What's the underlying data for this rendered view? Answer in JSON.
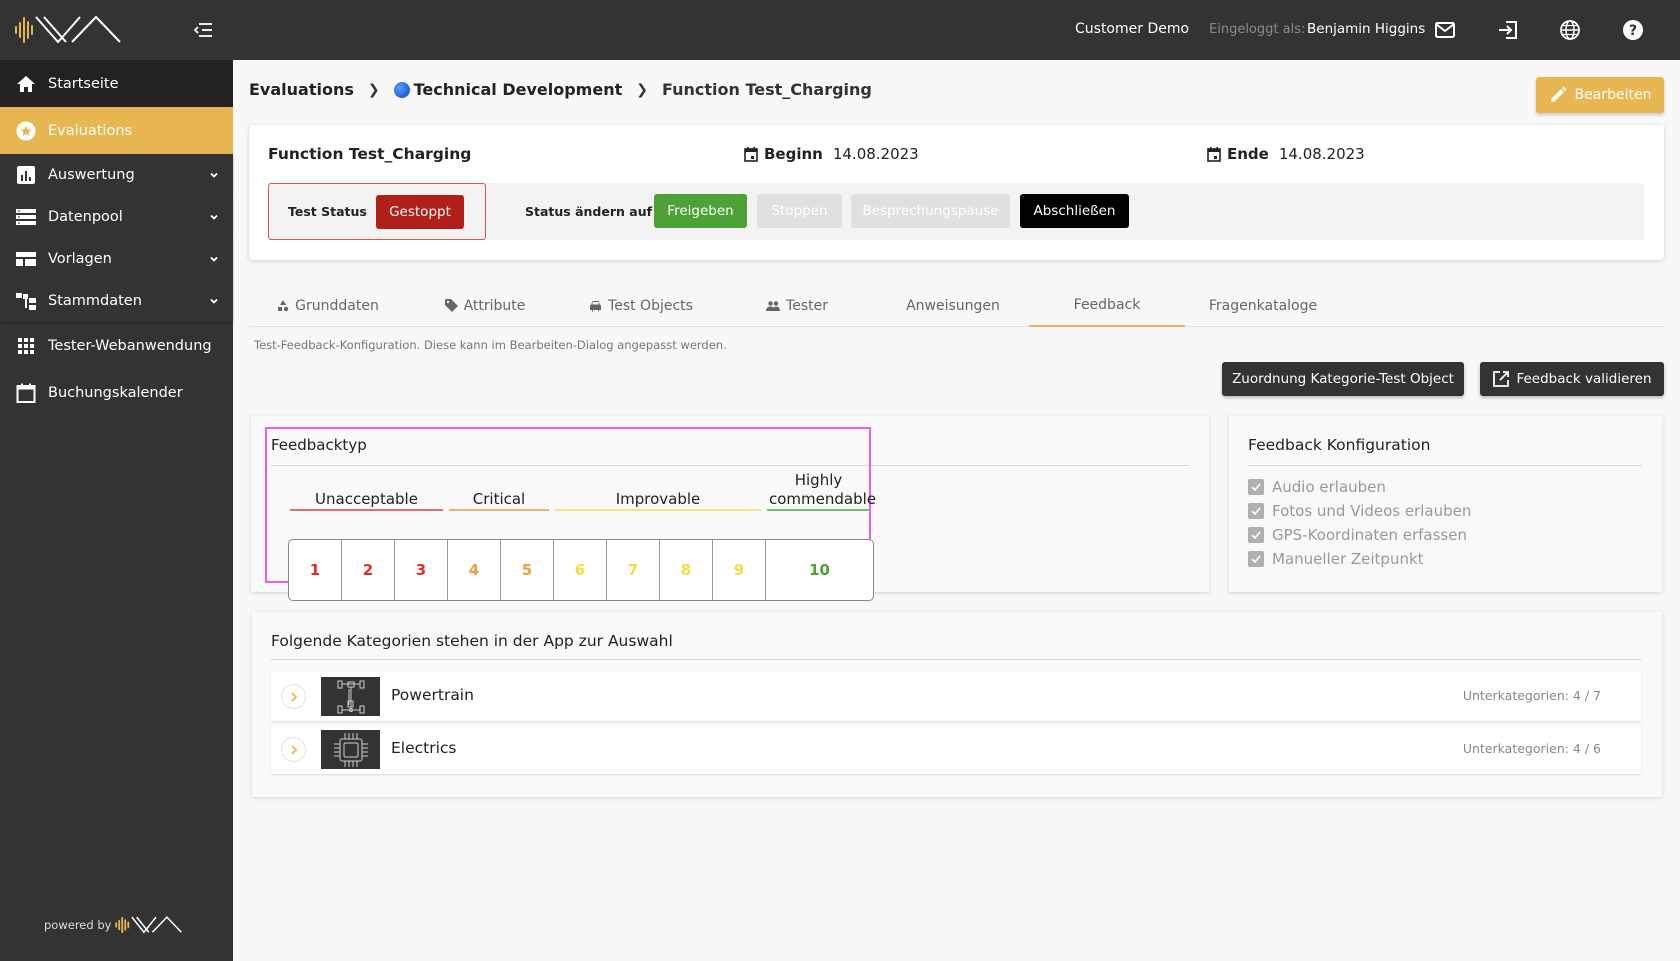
{
  "topbar": {
    "tenant": "Customer Demo",
    "logged_in_label": "Eingeloggt als:",
    "user_name": "Benjamin Higgins",
    "icons": [
      "mail-icon",
      "logout-icon",
      "globe-icon",
      "help-icon"
    ]
  },
  "sidebar": {
    "items": [
      {
        "label": "Startseite",
        "icon": "home-icon",
        "expandable": false
      },
      {
        "label": "Evaluations",
        "icon": "star-icon",
        "expandable": false,
        "active": true
      },
      {
        "label": "Auswertung",
        "icon": "bar-chart-icon",
        "expandable": true
      },
      {
        "label": "Datenpool",
        "icon": "storage-icon",
        "expandable": true
      },
      {
        "label": "Vorlagen",
        "icon": "template-icon",
        "expandable": true
      },
      {
        "label": "Stammdaten",
        "icon": "hierarchy-icon",
        "expandable": true
      },
      {
        "label": "Tester-Webanwendung",
        "icon": "apps-grid-icon",
        "expandable": false
      },
      {
        "label": "Buchungskalender",
        "icon": "calendar-icon",
        "expandable": false
      }
    ],
    "powered_by": "powered by"
  },
  "breadcrumb": {
    "items": [
      "Evaluations",
      "Technical Development",
      "Function Test_Charging"
    ]
  },
  "edit_button": "Bearbeiten",
  "header": {
    "title": "Function Test_Charging",
    "begin_label": "Beginn",
    "begin_date": "14.08.2023",
    "end_label": "Ende",
    "end_date": "14.08.2023",
    "status_label": "Test Status",
    "status_value": "Gestoppt",
    "change_label": "Status ändern auf",
    "actions": {
      "release": "Freigeben",
      "stop": "Stoppen",
      "pause": "Besprechungspause",
      "close": "Abschließen"
    }
  },
  "tabs": [
    {
      "label": "Grunddaten",
      "icon": "shapes-icon"
    },
    {
      "label": "Attribute",
      "icon": "tag-icon"
    },
    {
      "label": "Test Objects",
      "icon": "car-icon"
    },
    {
      "label": "Tester",
      "icon": "people-icon"
    },
    {
      "label": "Anweisungen",
      "icon": ""
    },
    {
      "label": "Feedback",
      "icon": "",
      "active": true
    },
    {
      "label": "Fragenkataloge",
      "icon": ""
    }
  ],
  "helper_text": "Test-Feedback-Konfiguration. Diese kann im Bearbeiten-Dialog angepasst werden.",
  "buttons": {
    "assign": "Zuordnung Kategorie-Test Object",
    "validate": "Feedback validieren"
  },
  "feedback_type": {
    "title": "Feedbacktyp",
    "groups": [
      {
        "label": "Unacceptable",
        "color": "#e07070",
        "values": [
          1,
          2,
          3
        ]
      },
      {
        "label": "Critical",
        "color": "#f0b070",
        "values": [
          4,
          5
        ]
      },
      {
        "label": "Improvable",
        "color": "#f5e680",
        "values": [
          6,
          7,
          8,
          9
        ]
      },
      {
        "label": "Highly commendable",
        "color": "#6fbf6f",
        "values": [
          10
        ]
      }
    ],
    "scale": [
      {
        "value": "1",
        "color": "#d9302a"
      },
      {
        "value": "2",
        "color": "#d9302a"
      },
      {
        "value": "3",
        "color": "#d9302a"
      },
      {
        "value": "4",
        "color": "#e8a23a"
      },
      {
        "value": "5",
        "color": "#e8a23a"
      },
      {
        "value": "6",
        "color": "#f2e13c"
      },
      {
        "value": "7",
        "color": "#f2e13c"
      },
      {
        "value": "8",
        "color": "#f2e13c"
      },
      {
        "value": "9",
        "color": "#f2e13c"
      },
      {
        "value": "10",
        "color": "#4ca235"
      }
    ]
  },
  "feedback_config": {
    "title": "Feedback Konfiguration",
    "options": [
      {
        "label": "Audio erlauben",
        "checked": true
      },
      {
        "label": "Fotos und Videos erlauben",
        "checked": true
      },
      {
        "label": "GPS-Koordinaten erfassen",
        "checked": true
      },
      {
        "label": "Manueller Zeitpunkt",
        "checked": true
      }
    ]
  },
  "categories": {
    "title": "Folgende Kategorien stehen in der App zur Auswahl",
    "items": [
      {
        "name": "Powertrain",
        "icon": "powertrain-icon",
        "subcategories": "Unterkategorien: 4 / 7"
      },
      {
        "name": "Electrics",
        "icon": "chip-icon",
        "subcategories": "Unterkategorien: 4 / 6"
      }
    ]
  },
  "colors": {
    "accent": "#e9b752",
    "sidebar_bg": "#333333",
    "stopped": "#b02018",
    "release": "#4ca235",
    "highlight": "#e85ef0"
  }
}
